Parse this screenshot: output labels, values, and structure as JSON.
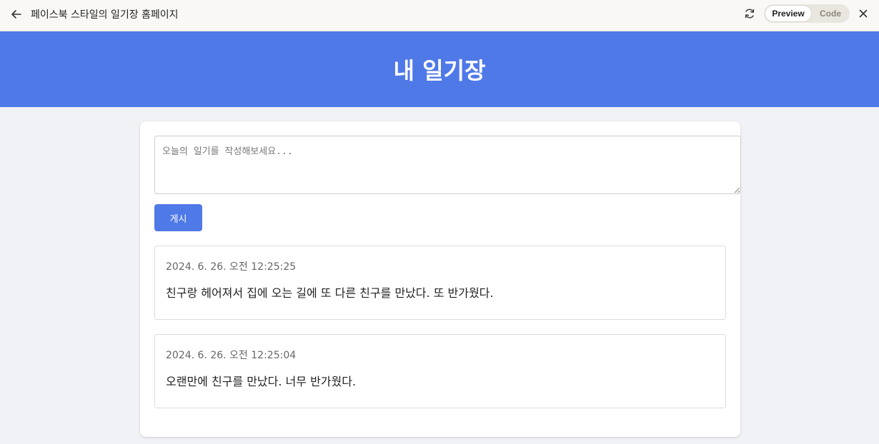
{
  "window": {
    "title": "페이스북 스타일의 일기장 홈페이지",
    "preview_label": "Preview",
    "code_label": "Code"
  },
  "header": {
    "title": "내 일기장"
  },
  "composer": {
    "placeholder": "오늘의 일기를 작성해보세요...",
    "value": "",
    "post_label": "게시"
  },
  "posts": [
    {
      "time": "2024. 6. 26. 오전 12:25:25",
      "text": "친구랑 헤어져서 집에 오는 길에 또 다른 친구를 만났다. 또 반가웠다."
    },
    {
      "time": "2024. 6. 26. 오전 12:25:04",
      "text": "오랜만에 친구를 만났다. 너무 반가웠다."
    }
  ],
  "icons": {
    "back": "arrow-left-icon",
    "refresh": "refresh-icon",
    "close": "close-icon"
  },
  "colors": {
    "accent": "#5079e8",
    "page_background": "#f0f2f5",
    "card_background": "#ffffff",
    "topbar_background": "#f9f8f6"
  }
}
